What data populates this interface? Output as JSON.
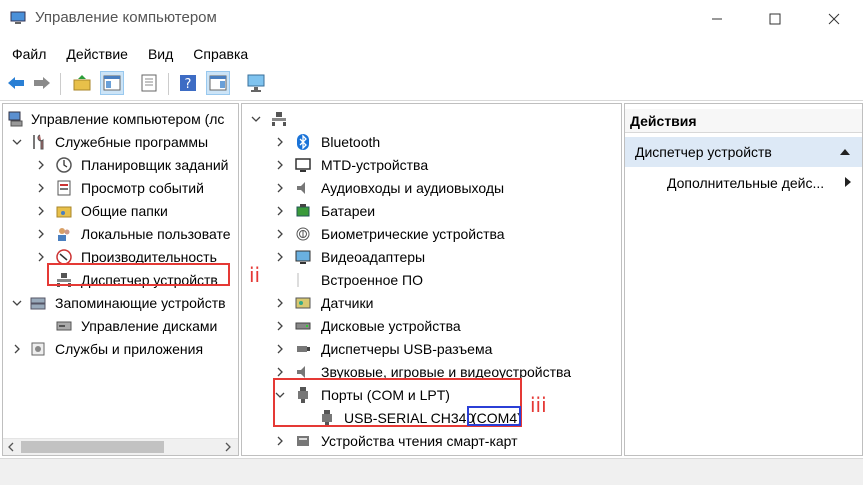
{
  "window": {
    "title": "Управление компьютером"
  },
  "menu": [
    "Файл",
    "Действие",
    "Вид",
    "Справка"
  ],
  "left_tree": {
    "root": "Управление компьютером (лс",
    "system_tools": "Служебные программы",
    "items": [
      "Планировщик заданий",
      "Просмотр событий",
      "Общие папки",
      "Локальные пользовате",
      "Производительность",
      "Диспетчер устройств"
    ],
    "storage": "Запоминающие устройств",
    "disk_mgmt": "Управление дисками",
    "services": "Службы и приложения"
  },
  "device_tree": {
    "categories": [
      "Bluetooth",
      "MTD-устройства",
      "Аудиовходы и аудиовыходы",
      "Батареи",
      "Биометрические устройства",
      "Видеоадаптеры",
      "Встроенное ПО",
      "Датчики",
      "Дисковые устройства",
      "Диспетчеры USB-разъема",
      "Звуковые, игровые и видеоустройства",
      "Порты (COM и LPT)",
      "USB-SERIAL CH340",
      "(COM4)",
      "Устройства чтения смарт-карт"
    ]
  },
  "annotations": {
    "ii": "ii",
    "iii": "iii"
  },
  "actions": {
    "header": "Действия",
    "section": "Диспетчер устройств",
    "more": "Дополнительные дейс..."
  },
  "colors": {
    "highlight_red": "#e53935",
    "highlight_blue": "#2b3fd6",
    "section_bg": "#dde9f6"
  }
}
